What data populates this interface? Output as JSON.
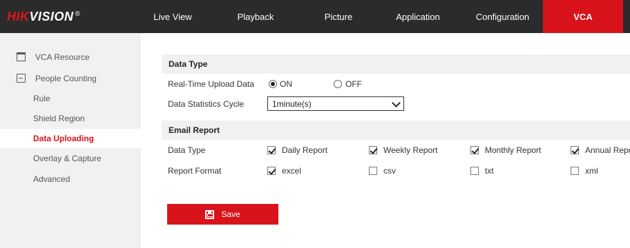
{
  "header": {
    "logo_red": "HIK",
    "logo_white": "VISION",
    "logo_reg": "®",
    "nav": [
      "Live View",
      "Playback",
      "Picture",
      "Application",
      "Configuration",
      "VCA"
    ],
    "active_nav": "VCA"
  },
  "sidebar": {
    "items": [
      {
        "label": "VCA Resource",
        "icon": "window-icon"
      },
      {
        "label": "People Counting",
        "icon": "chart-icon"
      },
      {
        "label": "Rule"
      },
      {
        "label": "Shield Region"
      },
      {
        "label": "Data Uploading"
      },
      {
        "label": "Overlay & Capture"
      },
      {
        "label": "Advanced"
      }
    ],
    "active": "Data Uploading"
  },
  "data_type_section": {
    "title": "Data Type",
    "realtime_label": "Real-Time Upload Data",
    "on_label": "ON",
    "off_label": "OFF",
    "realtime_value": "ON",
    "cycle_label": "Data Statistics Cycle",
    "cycle_value": "1minute(s)"
  },
  "email_section": {
    "title": "Email Report",
    "data_type_label": "Data Type",
    "report_types": [
      {
        "label": "Daily Report",
        "checked": true
      },
      {
        "label": "Weekly Report",
        "checked": true
      },
      {
        "label": "Monthly Report",
        "checked": true
      },
      {
        "label": "Annual Repo",
        "checked": true
      }
    ],
    "format_label": "Report Format",
    "formats": [
      {
        "label": "excel",
        "checked": true
      },
      {
        "label": "csv",
        "checked": false
      },
      {
        "label": "txt",
        "checked": false
      },
      {
        "label": "xml",
        "checked": false
      }
    ]
  },
  "save_button": {
    "label": "Save"
  },
  "colors": {
    "accent": "#d9131b",
    "topbar": "#2b2b2b",
    "panel": "#f1f1f1"
  }
}
